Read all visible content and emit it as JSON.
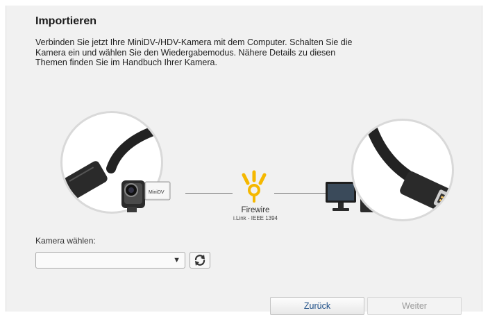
{
  "dialog": {
    "title": "Importieren",
    "description": "Verbinden Sie jetzt Ihre MiniDV-/HDV-Kamera mit dem Computer. Schalten Sie die Kamera ein und wählen Sie den Wiedergabemodus. Nähere Details zu diesen Themen finden Sie im Handbuch Ihrer Kamera."
  },
  "connection": {
    "label": "Firewire",
    "sublabel": "i.Link - IEEE 1394",
    "camera_logo_text": "MiniDV",
    "icons": [
      "firewire-cable-plug-icon",
      "camcorder-icon",
      "firewire-logo-icon",
      "computer-icon",
      "firewire-cable-socket-icon"
    ],
    "accent_color": "#f5b800"
  },
  "camera_select": {
    "label": "Kamera wählen:",
    "value": "",
    "arrow": "▼"
  },
  "buttons": {
    "back_label": "Zurück",
    "next_label": "Weiter",
    "next_enabled": false
  }
}
